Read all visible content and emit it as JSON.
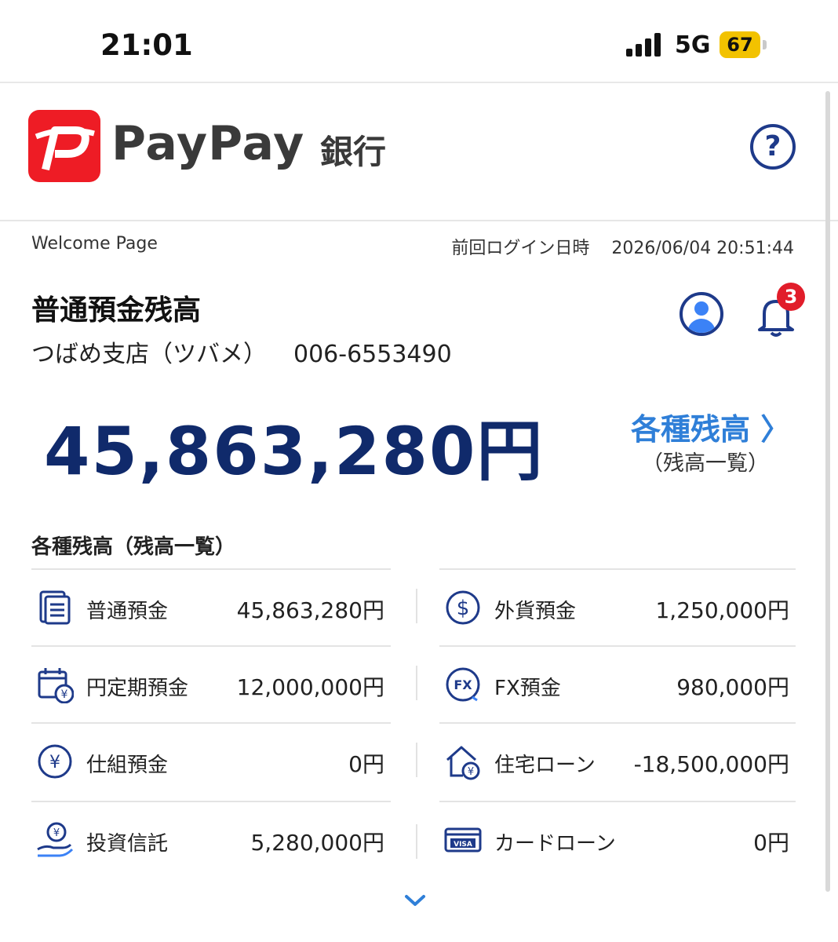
{
  "status_bar": {
    "time": "21:01",
    "network": "5G",
    "battery": "67"
  },
  "header": {
    "logo_text": "PayPay",
    "logo_bank": "銀行",
    "help_label": "?"
  },
  "page": {
    "welcome": "Welcome Page",
    "last_login_label": "前回ログイン日時",
    "last_login_value": "2026/06/04 20:51:44"
  },
  "account": {
    "title": "普通預金残高",
    "branch": "つばめ支店（ツバメ）",
    "number": "006-6553490",
    "balance": "45,863,280円",
    "notification_count": "3"
  },
  "various_link": {
    "label": "各種残高 〉",
    "sub": "（残高一覧）"
  },
  "balances_section": {
    "title": "各種残高（残高一覧）",
    "rows": [
      {
        "left": {
          "icon": "document-list-icon",
          "label": "普通預金",
          "amount": "45,863,280円"
        },
        "right": {
          "icon": "dollar-coin-icon",
          "label": "外貨預金",
          "amount": "1,250,000円"
        }
      },
      {
        "left": {
          "icon": "calendar-yen-icon",
          "label": "円定期預金",
          "amount": "12,000,000円"
        },
        "right": {
          "icon": "fx-icon",
          "label": "FX預金",
          "amount": "980,000円"
        }
      },
      {
        "left": {
          "icon": "yen-coin-icon",
          "label": "仕組預金",
          "amount": "0円"
        },
        "right": {
          "icon": "house-yen-icon",
          "label": "住宅ローン",
          "amount": "-18,500,000円"
        }
      },
      {
        "left": {
          "icon": "hand-yen-icon",
          "label": "投資信託",
          "amount": "5,280,000円"
        },
        "right": {
          "icon": "visa-card-icon",
          "label": "カードローン",
          "amount": "0円"
        }
      }
    ]
  },
  "colors": {
    "brand_red": "#ee1c25",
    "navy": "#102a6b",
    "link_blue": "#2f7fd8",
    "icon_blue": "#1e3a8a",
    "badge_red": "#e11d2a"
  }
}
